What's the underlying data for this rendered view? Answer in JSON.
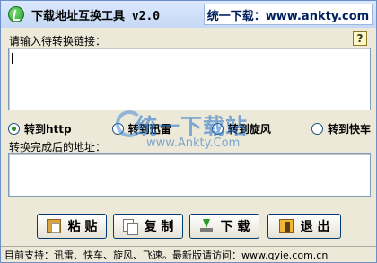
{
  "window": {
    "title": "下载地址互换工具 v2.0",
    "banner": "统一下载：www.ankty.com"
  },
  "input": {
    "label": "请输入待转换链接：",
    "value": ""
  },
  "help": {
    "glyph": "?"
  },
  "options": [
    {
      "label": "转到http",
      "checked": true
    },
    {
      "label": "转到迅雷",
      "checked": false
    },
    {
      "label": "转到旋风",
      "checked": false
    },
    {
      "label": "转到快车",
      "checked": false
    }
  ],
  "watermark": {
    "text": "统一下载站",
    "url": "www.Ankty.Com"
  },
  "output": {
    "label": "转换完成后的地址：",
    "value": ""
  },
  "buttons": {
    "paste": "粘 贴",
    "copy": "复 制",
    "download": "下 载",
    "exit": "退 出"
  },
  "status": {
    "text": "目前支持：讯雷、快车、旋风、飞速。最新版请访问：www.qyie.com.cn"
  },
  "colors": {
    "title_bg": "#c6d8f4",
    "window_bg": "#ece9d8",
    "button_border": "#003c74",
    "radio_check": "#2a8a2a"
  }
}
